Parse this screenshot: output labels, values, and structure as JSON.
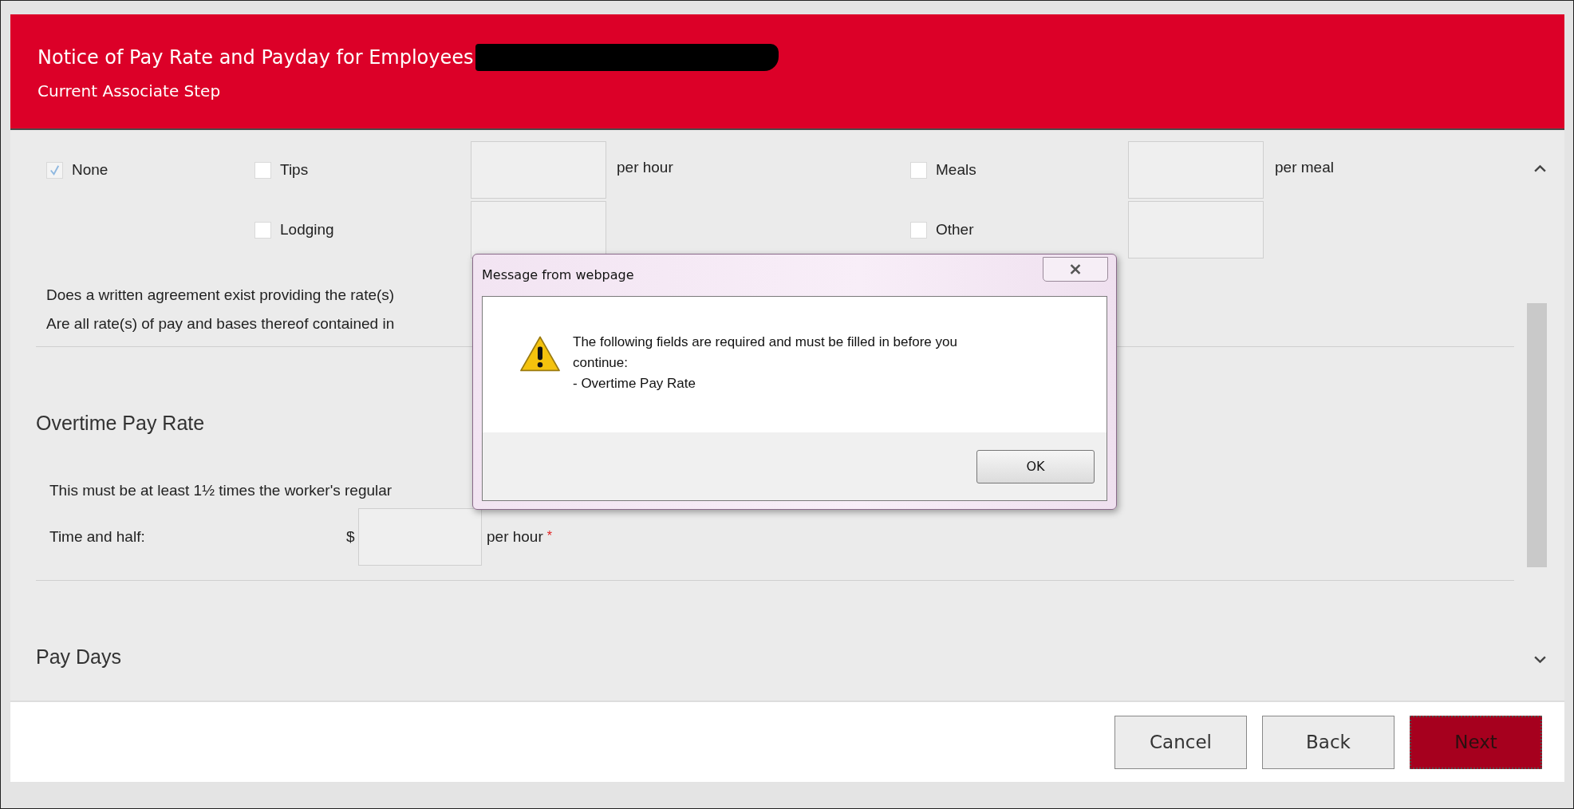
{
  "header": {
    "title": "Notice of Pay Rate and Payday for Employees",
    "subtitle": "Current Associate Step"
  },
  "allowances": [
    [
      {
        "kind": "checkbox",
        "label": "None",
        "checked": true
      },
      {
        "kind": "checkbox",
        "label": "Tips",
        "checked": false
      },
      {
        "kind": "field"
      },
      {
        "kind": "text",
        "text": "per hour"
      },
      {
        "kind": "checkbox",
        "label": "Meals",
        "checked": false
      },
      {
        "kind": "field"
      },
      {
        "kind": "text",
        "text": "per meal"
      }
    ],
    [
      {
        "kind": "blank"
      },
      {
        "kind": "checkbox",
        "label": "Lodging",
        "checked": false
      },
      {
        "kind": "field"
      },
      {
        "kind": "blank"
      },
      {
        "kind": "checkbox",
        "label": "Other",
        "checked": false
      },
      {
        "kind": "field"
      },
      {
        "kind": "blank"
      }
    ]
  ],
  "questions": [
    "Does a written agreement exist providing the rate(s)",
    "Are all rate(s) of pay and bases thereof contained in"
  ],
  "overtime": {
    "heading": "Overtime Pay Rate",
    "note": "This must be at least 1½ times the worker's regular",
    "label": "Time and half:",
    "currency": "$",
    "unit": "per hour",
    "required_mark": "*"
  },
  "pay_days": {
    "heading": "Pay Days"
  },
  "buttons": [
    {
      "label": "Cancel",
      "primary": false
    },
    {
      "label": "Back",
      "primary": false
    },
    {
      "label": "Next",
      "primary": true
    }
  ],
  "dialog": {
    "title": "Message from webpage",
    "message": "The following fields are required and must be filled in before you continue:",
    "items": [
      "- Overtime Pay Rate"
    ],
    "ok": "OK"
  }
}
